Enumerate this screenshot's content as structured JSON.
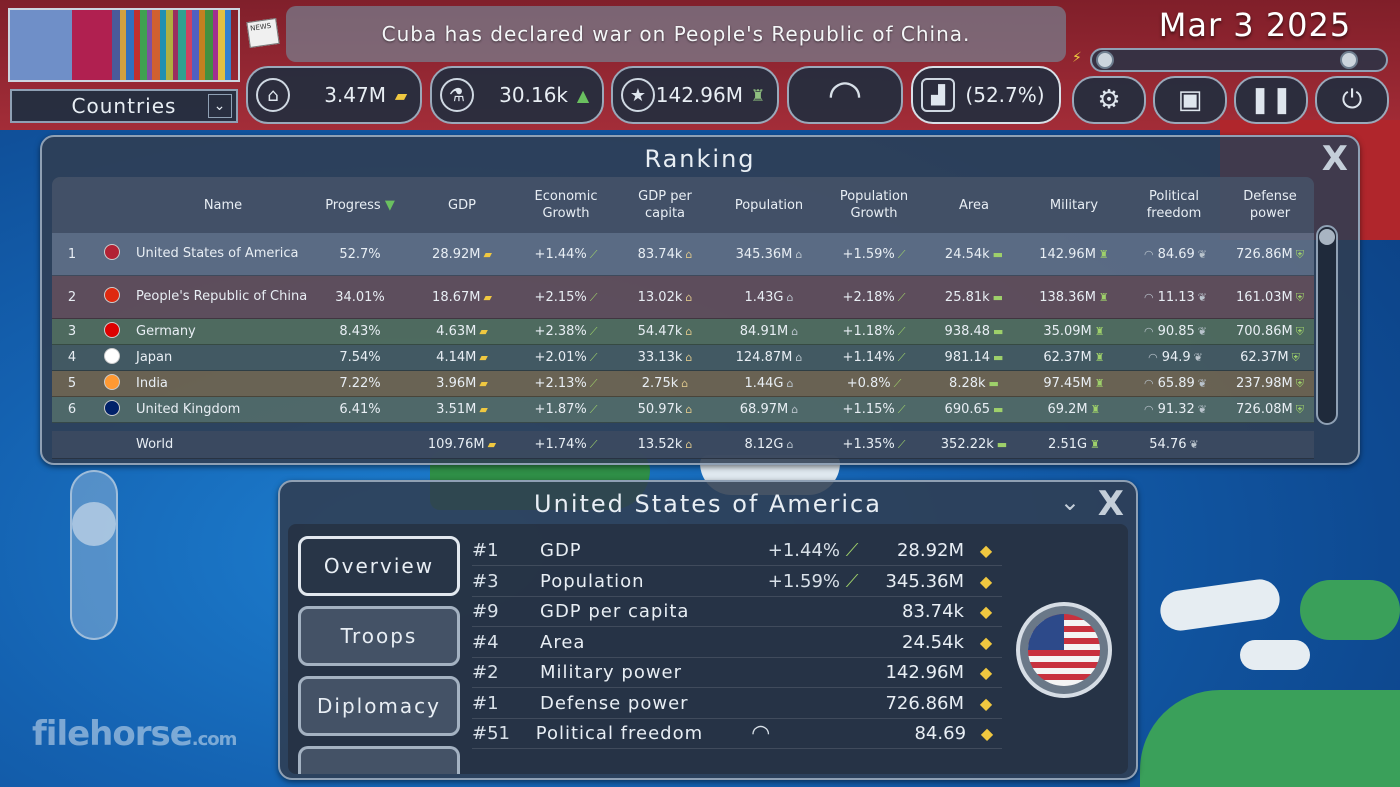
{
  "filter_select": {
    "label": "Countries",
    "chevron": "⌄"
  },
  "news": {
    "icon_label": "NEWS",
    "headline": "Cuba has declared war on People's Republic of China."
  },
  "date": "Mar 3 2025",
  "stats": {
    "money": {
      "value": "3.47M",
      "icon": "bank-icon"
    },
    "research": {
      "value": "30.16k",
      "icon": "flask-icon"
    },
    "military": {
      "value": "142.96M",
      "icon": "rank-star-icon"
    },
    "approval": {
      "value": "(52.7%)",
      "icon": "podium-icon"
    }
  },
  "toolbar": {
    "parliament_icon": "◠",
    "settings_icon": "⚙",
    "save_icon": "▣",
    "pause_icon": "❚❚",
    "power_icon": "⏻"
  },
  "ranking": {
    "title": "Ranking",
    "close": "X",
    "columns": [
      "Name",
      "Progress",
      "GDP",
      "Economic Growth",
      "GDP per capita",
      "Population",
      "Population Growth",
      "Area",
      "Military",
      "Political freedom",
      "Defense power"
    ],
    "rows": [
      {
        "rank": "1",
        "name": "United States of America",
        "flag": "#b22234",
        "progress": "52.7%",
        "gdp": "28.92M",
        "growth": "+1.44%",
        "gdp_pc": "83.74k",
        "population": "345.36M",
        "pop_growth": "+1.59%",
        "area": "24.54k",
        "military": "142.96M",
        "freedom": "84.69",
        "defense": "726.86M"
      },
      {
        "rank": "2",
        "name": "People's Republic of China",
        "flag": "#de2910",
        "progress": "34.01%",
        "gdp": "18.67M",
        "growth": "+2.15%",
        "gdp_pc": "13.02k",
        "population": "1.43G",
        "pop_growth": "+2.18%",
        "area": "25.81k",
        "military": "138.36M",
        "freedom": "11.13",
        "defense": "161.03M"
      },
      {
        "rank": "3",
        "name": "Germany",
        "flag": "#dd0000",
        "progress": "8.43%",
        "gdp": "4.63M",
        "growth": "+2.38%",
        "gdp_pc": "54.47k",
        "population": "84.91M",
        "pop_growth": "+1.18%",
        "area": "938.48",
        "military": "35.09M",
        "freedom": "90.85",
        "defense": "700.86M"
      },
      {
        "rank": "4",
        "name": "Japan",
        "flag": "#ffffff",
        "progress": "7.54%",
        "gdp": "4.14M",
        "growth": "+2.01%",
        "gdp_pc": "33.13k",
        "population": "124.87M",
        "pop_growth": "+1.14%",
        "area": "981.14",
        "military": "62.37M",
        "freedom": "94.9",
        "defense": "62.37M"
      },
      {
        "rank": "5",
        "name": "India",
        "flag": "#ff9933",
        "progress": "7.22%",
        "gdp": "3.96M",
        "growth": "+2.13%",
        "gdp_pc": "2.75k",
        "population": "1.44G",
        "pop_growth": "+0.8%",
        "area": "8.28k",
        "military": "97.45M",
        "freedom": "65.89",
        "defense": "237.98M"
      },
      {
        "rank": "6",
        "name": "United Kingdom",
        "flag": "#012169",
        "progress": "6.41%",
        "gdp": "3.51M",
        "growth": "+1.87%",
        "gdp_pc": "50.97k",
        "population": "68.97M",
        "pop_growth": "+1.15%",
        "area": "690.65",
        "military": "69.2M",
        "freedom": "91.32",
        "defense": "726.08M"
      }
    ],
    "world": {
      "name": "World",
      "gdp": "109.76M",
      "growth": "+1.74%",
      "gdp_pc": "13.52k",
      "population": "8.12G",
      "pop_growth": "+1.35%",
      "area": "352.22k",
      "military": "2.51G",
      "freedom": "54.76"
    }
  },
  "detail": {
    "title": "United States of America",
    "close": "X",
    "collapse": "⌄",
    "tabs": [
      "Overview",
      "Troops",
      "Diplomacy"
    ],
    "stats": [
      {
        "rank": "#1",
        "label": "GDP",
        "growth": "+1.44%",
        "value": "28.92M"
      },
      {
        "rank": "#3",
        "label": "Population",
        "growth": "+1.59%",
        "value": "345.36M"
      },
      {
        "rank": "#9",
        "label": "GDP per capita",
        "growth": "",
        "value": "83.74k"
      },
      {
        "rank": "#4",
        "label": "Area",
        "growth": "",
        "value": "24.54k"
      },
      {
        "rank": "#2",
        "label": "Military power",
        "growth": "",
        "value": "142.96M"
      },
      {
        "rank": "#1",
        "label": "Defense power",
        "growth": "",
        "value": "726.86M"
      },
      {
        "rank": "#51",
        "label": "Political freedom",
        "growth": "",
        "value": "84.69"
      }
    ]
  },
  "watermark": {
    "main": "filehorse",
    "suffix": ".com"
  }
}
